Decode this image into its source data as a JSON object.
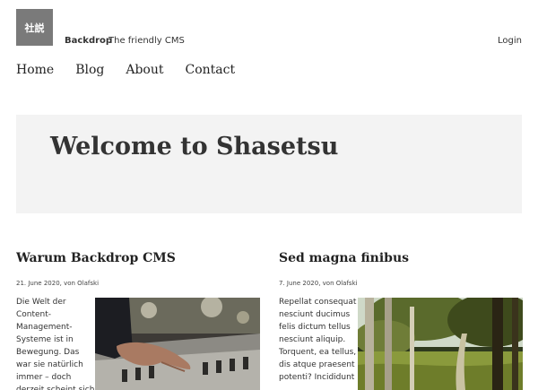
{
  "header": {
    "logo_text": "社説",
    "site_name": "Backdrop",
    "site_slogan": "The friendly CMS",
    "login_label": "Login"
  },
  "nav": {
    "items": [
      "Home",
      "Blog",
      "About",
      "Contact"
    ]
  },
  "hero": {
    "title": "Welcome to Shasetsu"
  },
  "articles": [
    {
      "title": "Warum Backdrop CMS",
      "meta": "21. June 2020, von Olafski",
      "teaser": "Die Welt der Content-Management-Systeme ist in Bewegung. Das war sie natürlich immer – doch derzeit scheint sich",
      "image_icon": "mixing-console-photo"
    },
    {
      "title": "Sed magna finibus",
      "meta": "7. June 2020, von Olafski",
      "teaser": "Repellat consequat nesciunt ducimus felis dictum tellus nesciunt aliquip. Torquent, ea tellus, dis atque praesent potenti? Incididunt",
      "image_icon": "forest-photo"
    }
  ]
}
